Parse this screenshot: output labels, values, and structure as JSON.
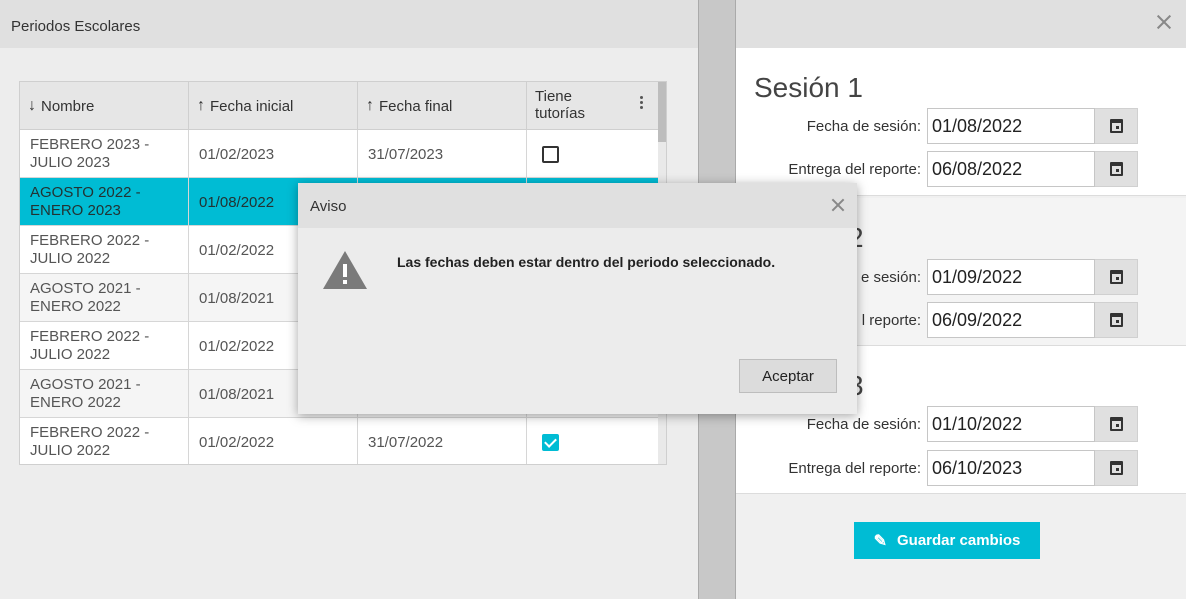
{
  "left": {
    "title": "Periodos Escolares",
    "columns": {
      "name": "Nombre",
      "start": "Fecha inicial",
      "end": "Fecha final",
      "tutorias_1": "Tiene",
      "tutorias_2": "tutorías"
    },
    "rows": [
      {
        "name1": "FEBRERO 2023 -",
        "name2": "JULIO 2023",
        "start": "01/02/2023",
        "end": "31/07/2023",
        "tutorias": false
      },
      {
        "name1": "AGOSTO 2022 -",
        "name2": "ENERO 2023",
        "start": "01/08/2022",
        "end": "",
        "tutorias": null
      },
      {
        "name1": "FEBRERO 2022 -",
        "name2": "JULIO 2022",
        "start": "01/02/2022",
        "end": "",
        "tutorias": null
      },
      {
        "name1": "AGOSTO 2021 -",
        "name2": "ENERO 2022",
        "start": "01/08/2021",
        "end": "",
        "tutorias": null
      },
      {
        "name1": "FEBRERO 2022 -",
        "name2": "JULIO 2022",
        "start": "01/02/2022",
        "end": "",
        "tutorias": null
      },
      {
        "name1": "AGOSTO 2021 -",
        "name2": "ENERO 2022",
        "start": "01/08/2021",
        "end": "",
        "tutorias": null
      },
      {
        "name1": "FEBRERO 2022 -",
        "name2": "JULIO 2022",
        "start": "01/02/2022",
        "end": "31/07/2022",
        "tutorias": true
      }
    ],
    "selected_row": 1
  },
  "right": {
    "sessions": [
      {
        "title": "Sesión 1",
        "fecha_label": "Fecha de sesión:",
        "fecha": "01/08/2022",
        "entrega_label": "Entrega del reporte:",
        "entrega": "06/08/2022"
      },
      {
        "title": "2",
        "fecha_label": "e sesión:",
        "fecha": "01/09/2022",
        "entrega_label": "l reporte:",
        "entrega": "06/09/2022"
      },
      {
        "title": "3",
        "fecha_label": "Fecha de sesión:",
        "fecha": "01/10/2022",
        "entrega_label": "Entrega del reporte:",
        "entrega": "06/10/2023"
      }
    ],
    "save_label": "Guardar cambios"
  },
  "dialog": {
    "title": "Aviso",
    "message": "Las fechas deben estar dentro del periodo seleccionado.",
    "ok_label": "Aceptar"
  },
  "colors": {
    "accent": "#00bcd4"
  }
}
